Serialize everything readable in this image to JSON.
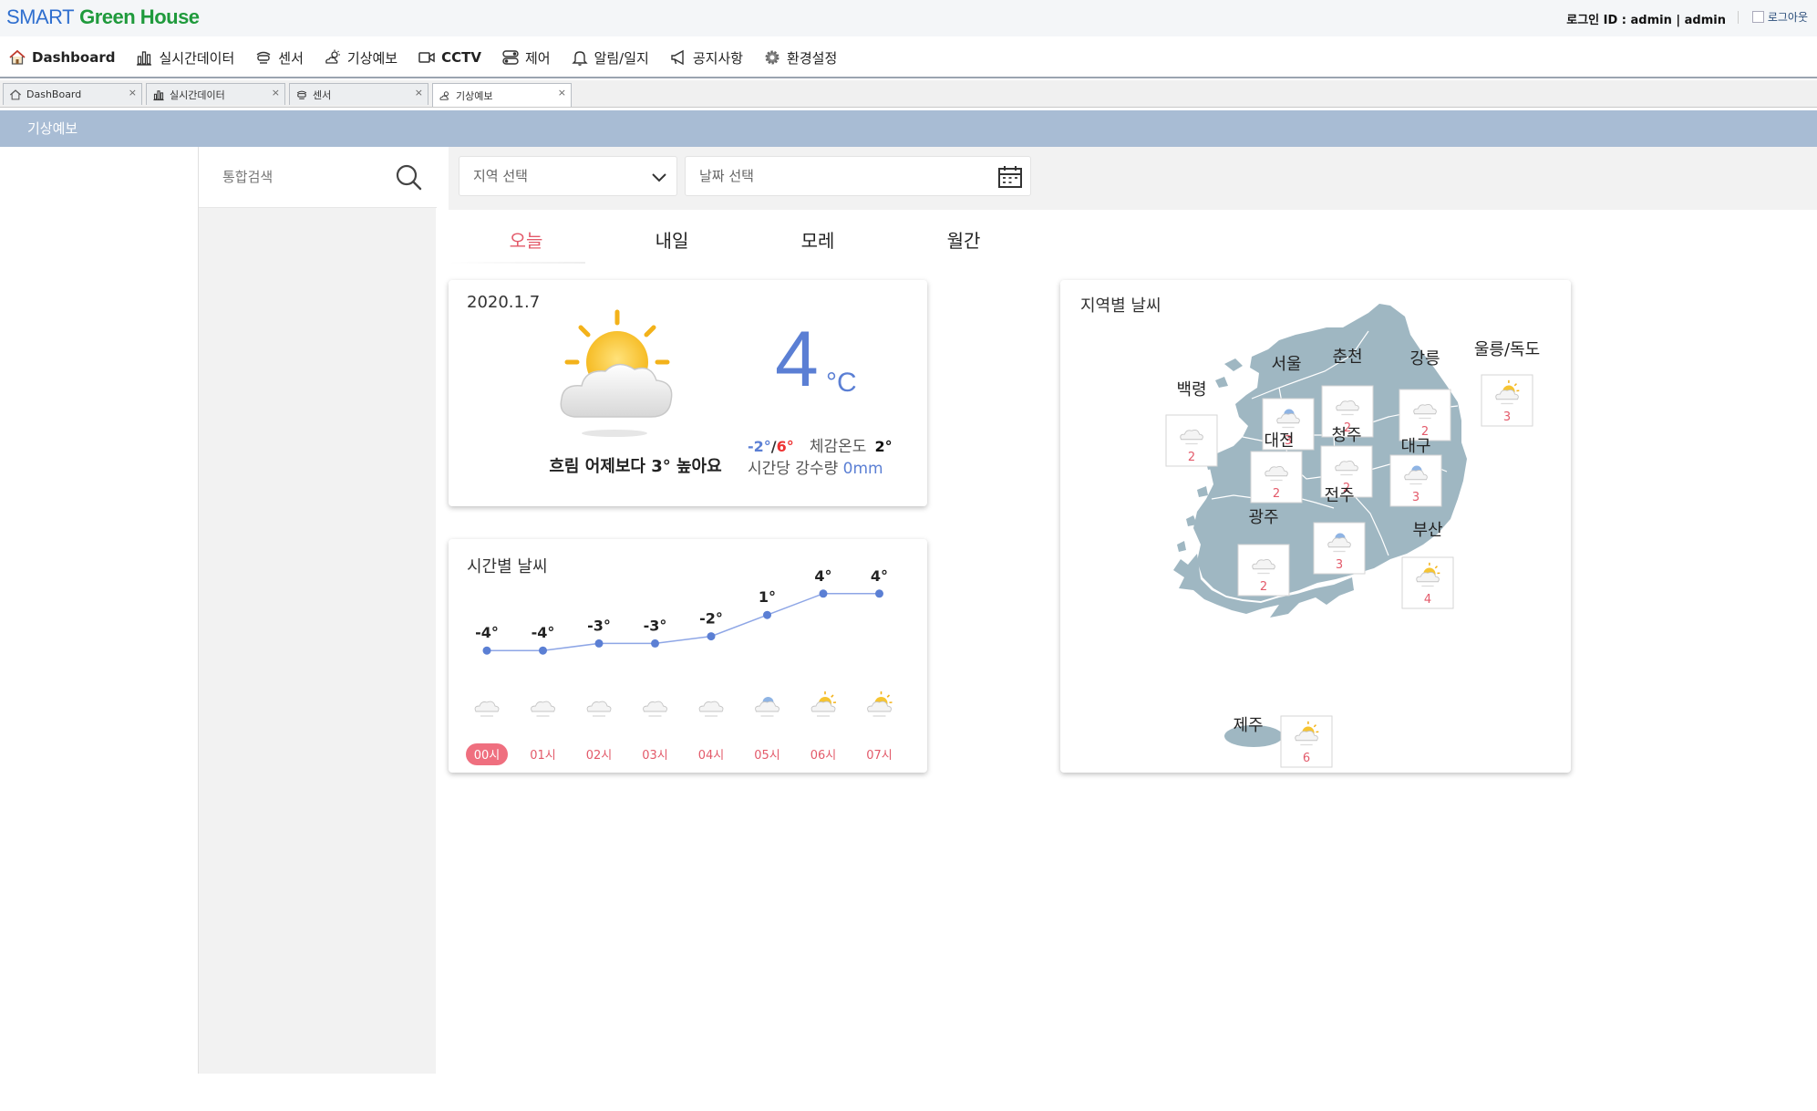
{
  "header": {
    "logo_part1": "SMART",
    "logo_part2": "Green House",
    "login_info": "로그인 ID : admin | admin",
    "logout_label": "로그아웃"
  },
  "menu": [
    {
      "label": "Dashboard",
      "icon": "home-icon"
    },
    {
      "label": "실시간데이터",
      "icon": "bar-chart-icon"
    },
    {
      "label": "센서",
      "icon": "sensor-icon"
    },
    {
      "label": "기상예보",
      "icon": "weather-icon"
    },
    {
      "label": "CCTV",
      "icon": "camera-icon"
    },
    {
      "label": "제어",
      "icon": "control-icon"
    },
    {
      "label": "알림/일지",
      "icon": "bell-icon"
    },
    {
      "label": "공지사항",
      "icon": "megaphone-icon"
    },
    {
      "label": "환경설정",
      "icon": "gear-icon"
    }
  ],
  "tabs": [
    {
      "label": "DashBoard",
      "icon": "home-icon",
      "close": "×"
    },
    {
      "label": "실시간데이터",
      "icon": "bar-chart-icon",
      "close": "×"
    },
    {
      "label": "센서",
      "icon": "sensor-icon",
      "close": "×"
    },
    {
      "label": "기상예보",
      "icon": "weather-icon",
      "close": "×",
      "active": true
    }
  ],
  "page_heading": "기상예보",
  "search": {
    "placeholder": "통합검색"
  },
  "filters": {
    "region_placeholder": "지역 선택",
    "date_placeholder": "날짜 선택"
  },
  "day_tabs": [
    {
      "label": "오늘",
      "active": true
    },
    {
      "label": "내일"
    },
    {
      "label": "모레"
    },
    {
      "label": "월간"
    }
  ],
  "today": {
    "date": "2020.1.7",
    "description": "흐림 어제보다 3° 높아요",
    "temperature": "4",
    "unit": "°C",
    "min": "-2°",
    "slash": "/",
    "max": "6°",
    "feels_label": "체감온도",
    "feels_value": "2°",
    "rain_label": "시간당 강수량",
    "rain_value": "0mm"
  },
  "hourly": {
    "title": "시간별 날씨",
    "hours": [
      {
        "time": "00시",
        "temp": -4,
        "label": "-4°",
        "icon": "cloud-icon",
        "selected": true
      },
      {
        "time": "01시",
        "temp": -4,
        "label": "-4°",
        "icon": "cloud-icon"
      },
      {
        "time": "02시",
        "temp": -3,
        "label": "-3°",
        "icon": "cloud-icon"
      },
      {
        "time": "03시",
        "temp": -3,
        "label": "-3°",
        "icon": "cloud-icon"
      },
      {
        "time": "04시",
        "temp": -2,
        "label": "-2°",
        "icon": "cloud-icon"
      },
      {
        "time": "05시",
        "temp": 1,
        "label": "1°",
        "icon": "cloud-snow-icon"
      },
      {
        "time": "06시",
        "temp": 4,
        "label": "4°",
        "icon": "partly-sunny-icon"
      },
      {
        "time": "07시",
        "temp": 4,
        "label": "4°",
        "icon": "partly-sunny-icon"
      }
    ]
  },
  "regional": {
    "title": "지역별 날씨",
    "regions": [
      {
        "name": "서울",
        "value": "3",
        "icon": "cloud-snow-icon"
      },
      {
        "name": "춘천",
        "value": "2",
        "icon": "cloud-icon"
      },
      {
        "name": "강릉",
        "value": "2",
        "icon": "cloud-icon"
      },
      {
        "name": "울릉/독도",
        "value": "3",
        "icon": "partly-sunny-icon"
      },
      {
        "name": "백령",
        "value": "2",
        "icon": "cloud-icon"
      },
      {
        "name": "대전",
        "value": "2",
        "icon": "cloud-icon"
      },
      {
        "name": "청주",
        "value": "2",
        "icon": "cloud-icon"
      },
      {
        "name": "대구",
        "value": "3",
        "icon": "cloud-snow-icon"
      },
      {
        "name": "전주",
        "value": "3",
        "icon": "cloud-snow-icon"
      },
      {
        "name": "광주",
        "value": "2",
        "icon": "cloud-icon"
      },
      {
        "name": "부산",
        "value": "4",
        "icon": "partly-sunny-icon"
      },
      {
        "name": "제주",
        "value": "6",
        "icon": "partly-sunny-icon"
      }
    ]
  },
  "colors": {
    "accent": "#5b7fd4",
    "max_temp": "#e33333",
    "heading_bar": "#a8bcd4",
    "active_tab": "#e35a6a",
    "map_land": "#9fb7c2"
  }
}
